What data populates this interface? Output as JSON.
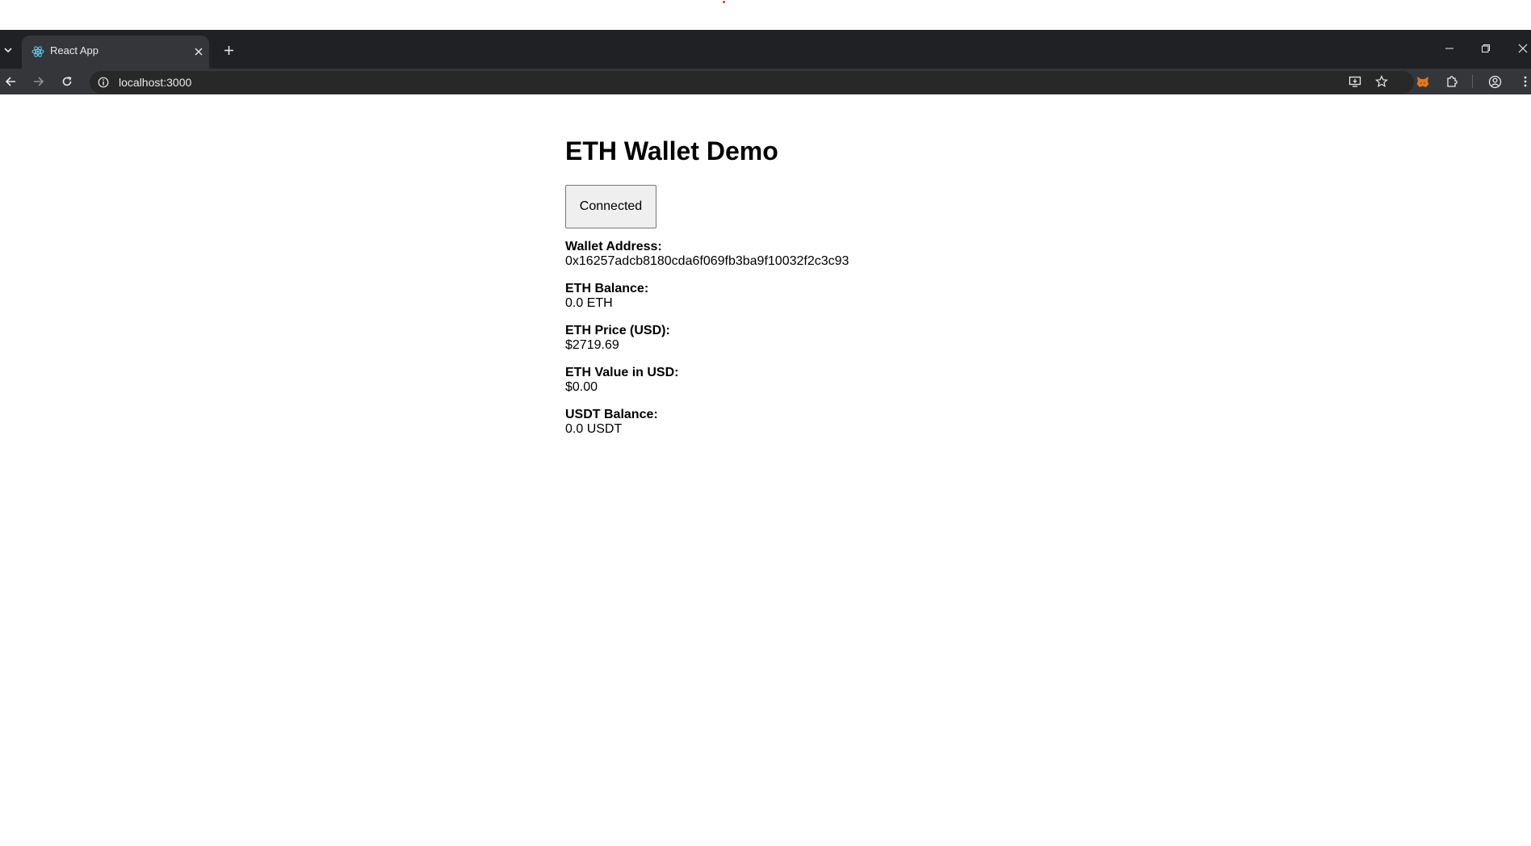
{
  "browser": {
    "tab": {
      "title": "React App",
      "favicon": "react-logo-icon"
    },
    "address_bar": {
      "url": "localhost:3000"
    },
    "icons": {
      "tab_search": "chevron-down-icon",
      "tab_close": "close-icon",
      "new_tab": "plus-icon",
      "minimize": "minimize-icon",
      "restore": "restore-icon",
      "close_window": "close-icon",
      "back": "arrow-left-icon",
      "forward": "arrow-right-icon",
      "reload": "reload-icon",
      "site_info": "info-icon",
      "install_app": "install-icon",
      "bookmark": "star-icon",
      "extension": "metamask-fox-icon",
      "extensions": "puzzle-icon",
      "profile": "profile-icon",
      "menu": "kebab-menu-icon"
    },
    "colors": {
      "tabstrip": "#202124",
      "active_tab": "#35363a",
      "toolbar": "#35363a",
      "omnibox": "#282828"
    }
  },
  "page": {
    "title": "ETH Wallet Demo",
    "connect_button": "Connected",
    "fields": [
      {
        "label": "Wallet Address:",
        "value": "0x16257adcb8180cda6f069fb3ba9f10032f2c3c93"
      },
      {
        "label": "ETH Balance:",
        "value": "0.0 ETH"
      },
      {
        "label": "ETH Price (USD):",
        "value": "$2719.69"
      },
      {
        "label": "ETH Value in USD:",
        "value": "$0.00"
      },
      {
        "label": "USDT Balance:",
        "value": "0.0 USDT"
      }
    ]
  }
}
